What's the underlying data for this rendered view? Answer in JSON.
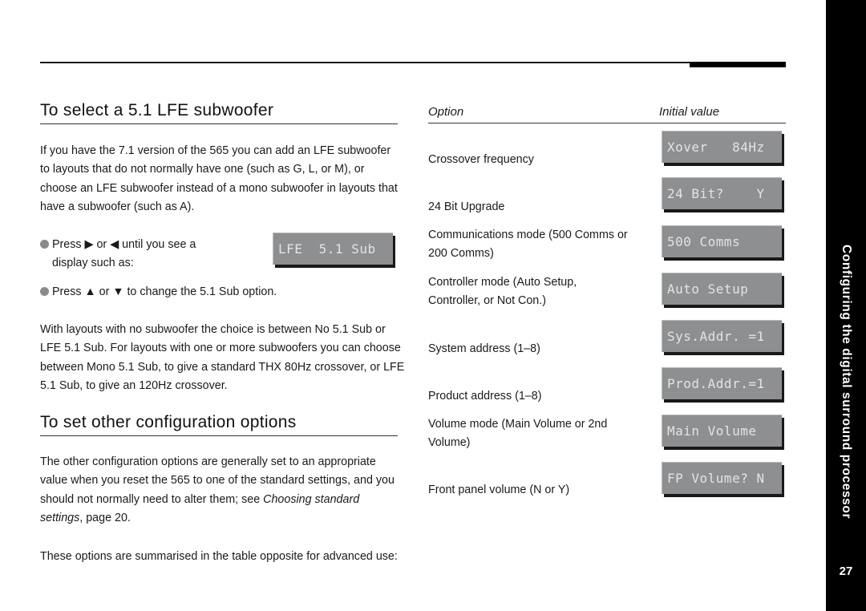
{
  "side_tab": {
    "title": "Configuring the digital surround processor",
    "page_number": "27"
  },
  "section1": {
    "heading": "To select a 5.1 LFE subwoofer",
    "intro": "If you have the 7.1 version of the 565 you can add an LFE subwoofer to layouts that do not normally have one (such as G, L, or M), or choose an LFE subwoofer instead of a mono subwoofer in layouts that have a subwoofer (such as A).",
    "bullet1_line1": "Press ▶ or ◀ until you see a",
    "bullet1_line2": "display such as:",
    "display_example": "LFE  5.1 Sub",
    "bullet2": "Press ▲ or ▼ to change the 5.1 Sub option.",
    "note": "With layouts with no subwoofer the choice is between No 5.1 Sub or LFE 5.1 Sub. For layouts with one or more subwoofers you can choose between Mono 5.1 Sub, to give a standard THX 80Hz crossover, or LFE 5.1 Sub, to give an 120Hz crossover."
  },
  "section2": {
    "heading": "To set other configuration options",
    "para1_start": "The other configuration options are generally set to an appropriate value when you reset the 565 to one of the standard settings, and you should not normally need to alter them; see ",
    "para1_link": "Choosing standard settings",
    "para1_end": ", page 20.",
    "para2": "These options are summarised in the table opposite for advanced use:"
  },
  "table": {
    "headers": {
      "option": "Option",
      "initial_value": "Initial value"
    },
    "rows": [
      {
        "option": "Crossover frequency",
        "display": "Xover   84Hz"
      },
      {
        "option": "24 Bit Upgrade",
        "display": "24 Bit?    Y"
      },
      {
        "option": "Communications mode (500 Comms or 200 Comms)",
        "display": "500 Comms"
      },
      {
        "option": "Controller mode (Auto Setup, Controller, or Not Con.)",
        "display": "Auto Setup"
      },
      {
        "option": "System address (1–8)",
        "display": "Sys.Addr. =1"
      },
      {
        "option": "Product address (1–8)",
        "display": "Prod.Addr.=1"
      },
      {
        "option": "Volume mode (Main Volume or 2nd Volume)",
        "display": "Main Volume"
      },
      {
        "option": "Front panel volume (N or Y)",
        "display": "FP Volume? N"
      }
    ]
  }
}
